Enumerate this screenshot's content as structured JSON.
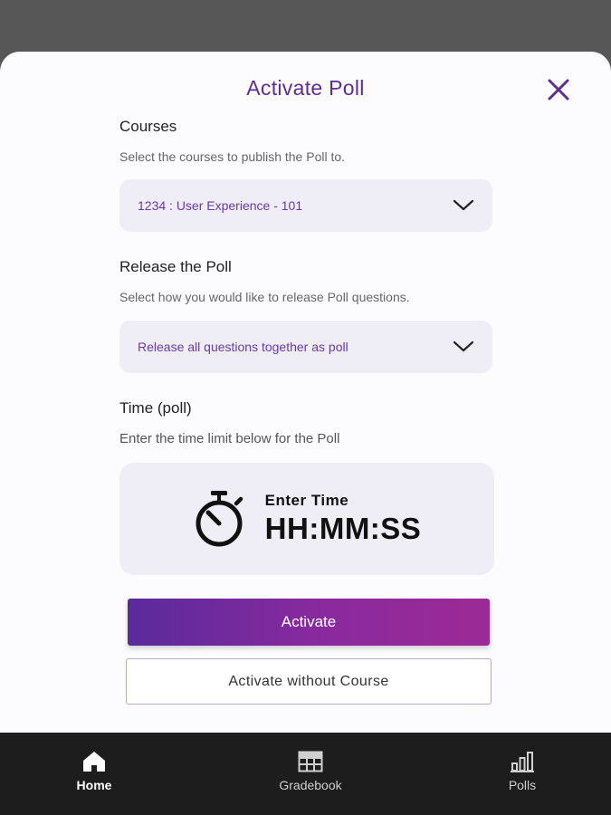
{
  "dialog": {
    "title": "Activate Poll",
    "close_icon": "close-icon"
  },
  "courses": {
    "label": "Courses",
    "help": "Select the courses to publish the Poll to.",
    "selected": "1234 : User Experience - 101"
  },
  "release": {
    "label": "Release the Poll",
    "help": "Select how you would like to release Poll questions.",
    "selected": "Release all questions together as poll"
  },
  "time": {
    "label": "Time (poll)",
    "help": "Enter the time limit below for the Poll",
    "input_label": "Enter Time",
    "input_value": "HH:MM:SS",
    "icon": "stopwatch-icon"
  },
  "buttons": {
    "activate": "Activate",
    "activate_without_course": "Activate without Course"
  },
  "nav": {
    "items": [
      {
        "label": "Home",
        "icon": "home-icon",
        "active": true
      },
      {
        "label": "Gradebook",
        "icon": "gradebook-icon",
        "active": false
      },
      {
        "label": "Polls",
        "icon": "polls-icon",
        "active": false
      }
    ]
  },
  "colors": {
    "accent": "#5e2d91",
    "dropdown_bg": "#efedf6",
    "nav_bg": "#1d1d1d",
    "overlay": "#575757"
  }
}
